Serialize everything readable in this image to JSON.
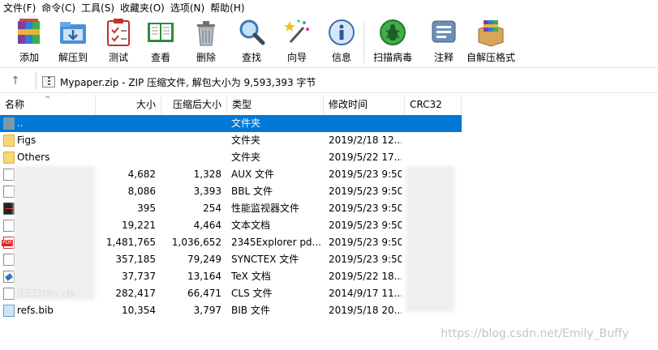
{
  "menu": [
    "文件(F)",
    "命令(C)",
    "工具(S)",
    "收藏夹(O)",
    "选项(N)",
    "帮助(H)"
  ],
  "toolbar": [
    {
      "label": "添加",
      "icon": "add-archive-icon"
    },
    {
      "label": "解压到",
      "icon": "extract-to-icon"
    },
    {
      "label": "测试",
      "icon": "test-icon"
    },
    {
      "label": "查看",
      "icon": "view-book-icon"
    },
    {
      "label": "删除",
      "icon": "delete-trash-icon"
    },
    {
      "label": "查找",
      "icon": "find-magnifier-icon"
    },
    {
      "label": "向导",
      "icon": "wizard-wand-icon"
    },
    {
      "label": "信息",
      "icon": "info-icon"
    },
    {
      "label": "扫描病毒",
      "icon": "virus-scan-icon"
    },
    {
      "label": "注释",
      "icon": "comment-icon"
    },
    {
      "label": "自解压格式",
      "icon": "sfx-box-icon"
    }
  ],
  "address": {
    "text": "Mypaper.zip - ZIP 压缩文件, 解包大小为 9,593,393 字节"
  },
  "columns": {
    "name": "名称",
    "size": "大小",
    "packed": "压缩后大小",
    "type": "类型",
    "modified": "修改时间",
    "crc": "CRC32"
  },
  "rows": [
    {
      "name": "..",
      "size": "",
      "packed": "",
      "type": "文件夹",
      "modified": "",
      "crc": "",
      "icon": "up-folder",
      "selected": true
    },
    {
      "name": "Figs",
      "size": "",
      "packed": "",
      "type": "文件夹",
      "modified": "2019/2/18 12...",
      "crc": "",
      "icon": "folder"
    },
    {
      "name": "Others",
      "size": "",
      "packed": "",
      "type": "文件夹",
      "modified": "2019/5/22 17...",
      "crc": "",
      "icon": "folder"
    },
    {
      "name": "",
      "size": "4,682",
      "packed": "1,328",
      "type": "AUX 文件",
      "modified": "2019/5/23 9:50",
      "crc": "",
      "icon": "doc"
    },
    {
      "name": "",
      "size": "8,086",
      "packed": "3,393",
      "type": "BBL 文件",
      "modified": "2019/5/23 9:50",
      "crc": "",
      "icon": "doc"
    },
    {
      "name": "",
      "size": "395",
      "packed": "254",
      "type": "性能监视器文件",
      "modified": "2019/5/23 9:50",
      "crc": "",
      "icon": "perf"
    },
    {
      "name": "",
      "size": "19,221",
      "packed": "4,464",
      "type": "文本文档",
      "modified": "2019/5/23 9:50",
      "crc": "",
      "icon": "doc"
    },
    {
      "name": "",
      "size": "1,481,765",
      "packed": "1,036,652",
      "type": "2345Explorer pd...",
      "modified": "2019/5/23 9:50",
      "crc": "",
      "icon": "pdf"
    },
    {
      "name": "",
      "size": "357,185",
      "packed": "79,249",
      "type": "SYNCTEX 文件",
      "modified": "2019/5/23 9:50",
      "crc": "",
      "icon": "doc"
    },
    {
      "name": "",
      "size": "37,737",
      "packed": "13,164",
      "type": "TeX 文档",
      "modified": "2019/5/22 18...",
      "crc": "",
      "icon": "tex"
    },
    {
      "name": "IEEEtran.cls",
      "size": "282,417",
      "packed": "66,471",
      "type": "CLS 文件",
      "modified": "2014/9/17 11...",
      "crc": "",
      "icon": "doc"
    },
    {
      "name": "refs.bib",
      "size": "10,354",
      "packed": "3,797",
      "type": "BIB 文件",
      "modified": "2019/5/18 20...",
      "crc": "",
      "icon": "bib"
    }
  ],
  "watermark": "https://blog.csdn.net/Emily_Buffy"
}
